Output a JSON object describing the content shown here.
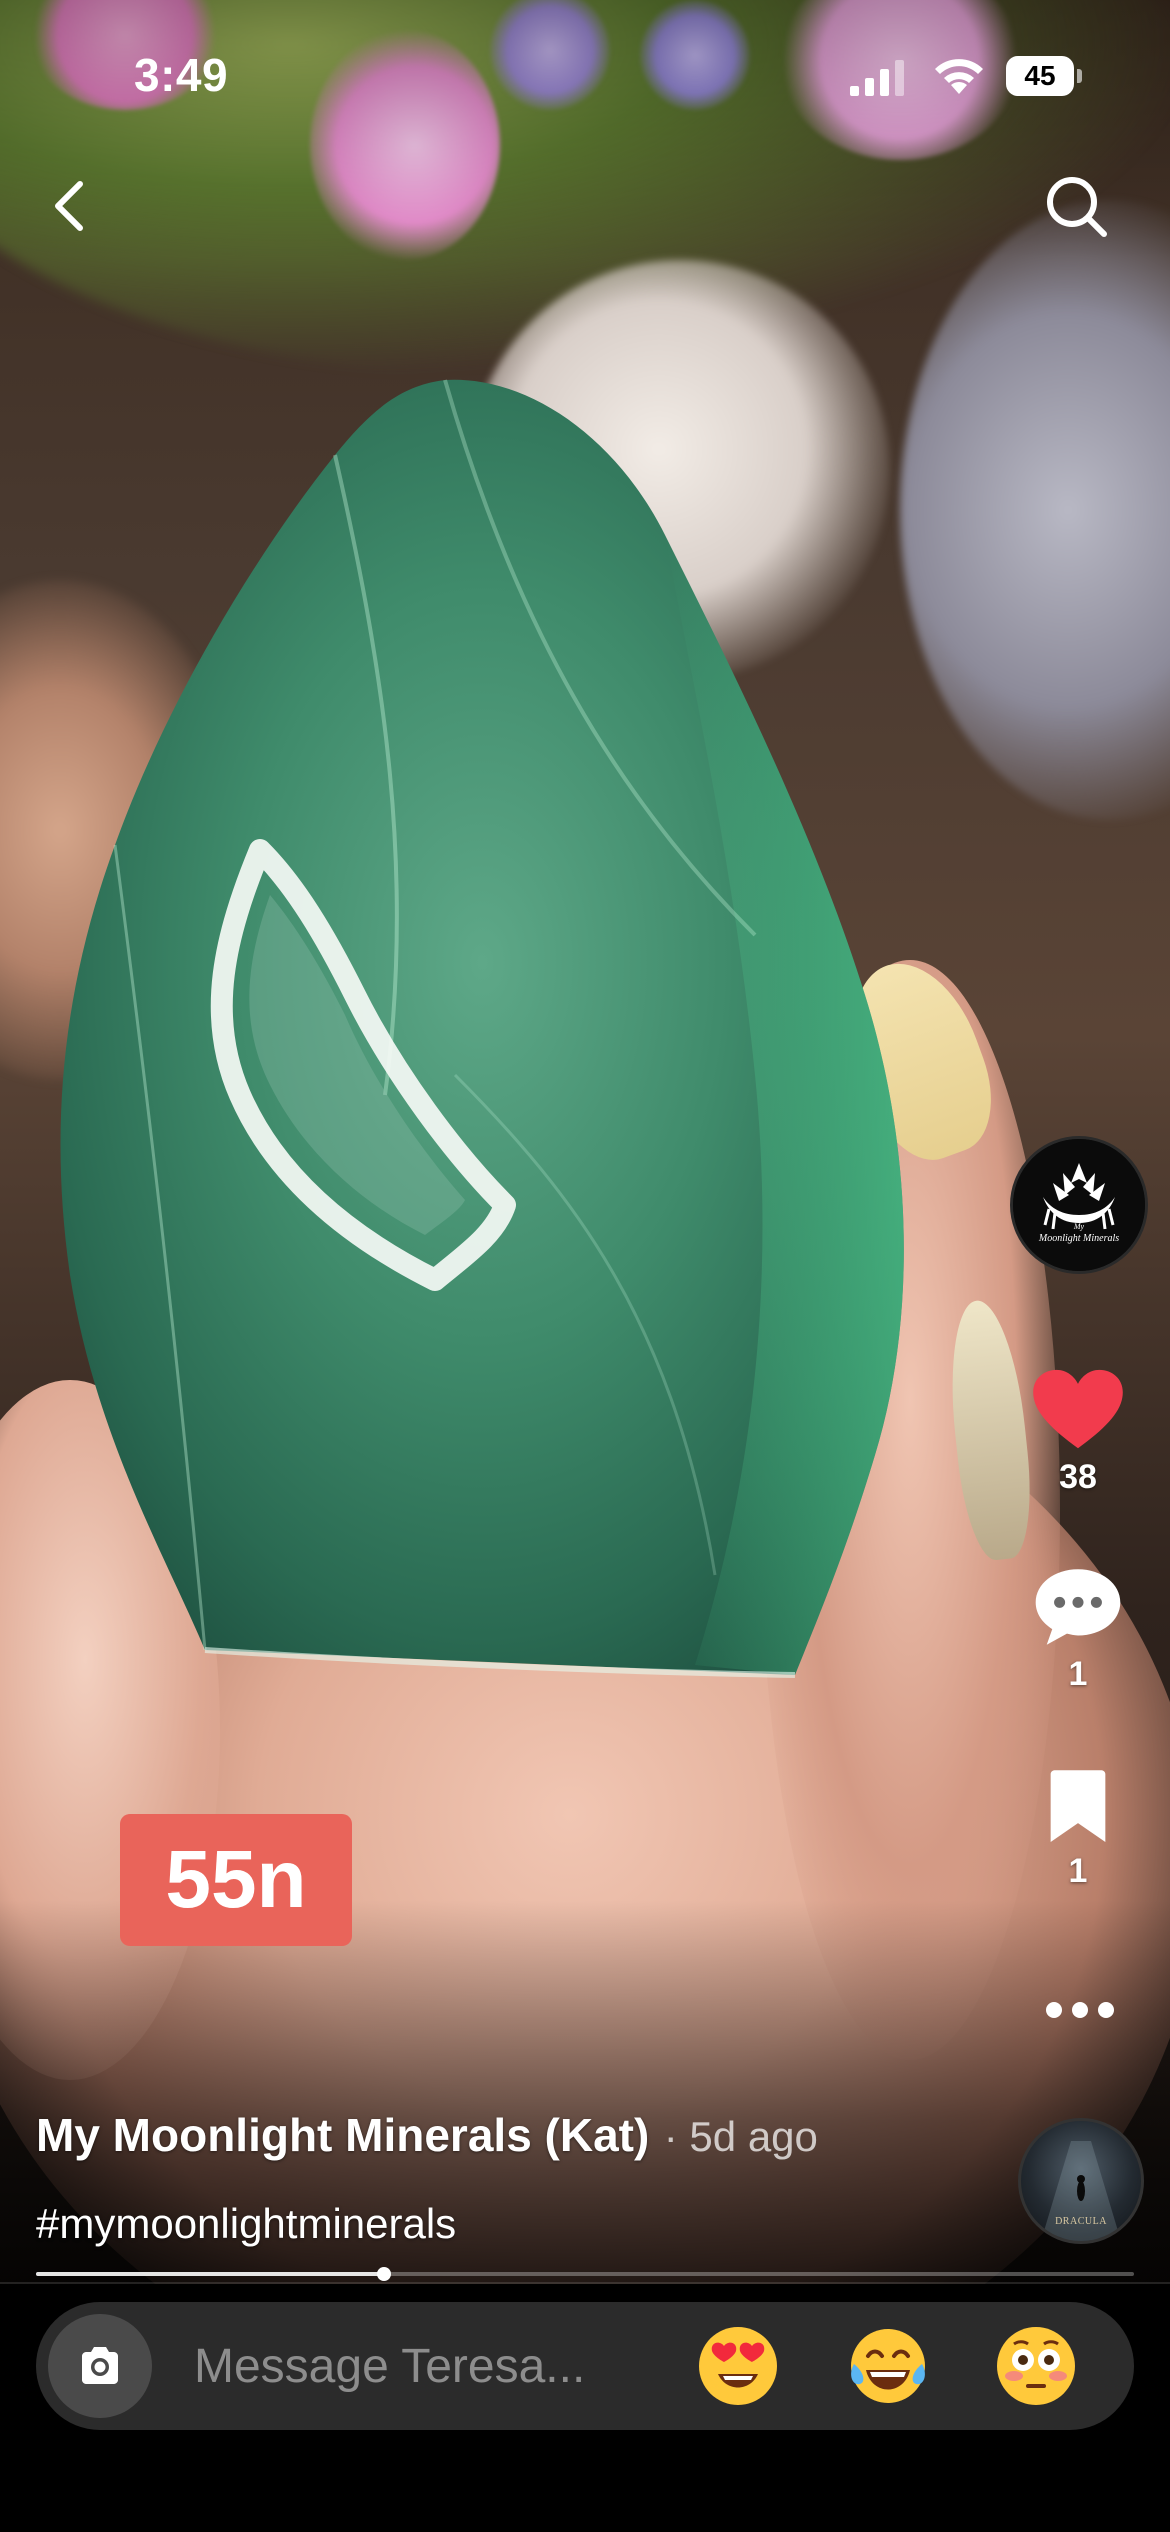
{
  "status_bar": {
    "time": "3:49",
    "battery_level": "45"
  },
  "nav": {
    "back_icon": "chevron-left-icon",
    "search_icon": "search-icon"
  },
  "creator": {
    "avatar_text_top": "My",
    "avatar_text_bottom": "Moonlight Minerals"
  },
  "actions": {
    "like_count": "38",
    "comment_count": "1",
    "save_count": "1",
    "like_color": "#f23b4d"
  },
  "sticker": {
    "text": "55n",
    "color": "#e9645a"
  },
  "post": {
    "author": "My Moonlight Minerals (Kat)",
    "time": "· 5d ago",
    "hashtag": "#mymoonlightminerals",
    "progress": 0.317
  },
  "sound": {
    "disc_label": "DRACULA"
  },
  "message_bar": {
    "placeholder": "Message Teresa...",
    "quick_reactions": [
      "heart-eyes-emoji",
      "tears-of-joy-emoji",
      "flushed-face-emoji"
    ]
  }
}
